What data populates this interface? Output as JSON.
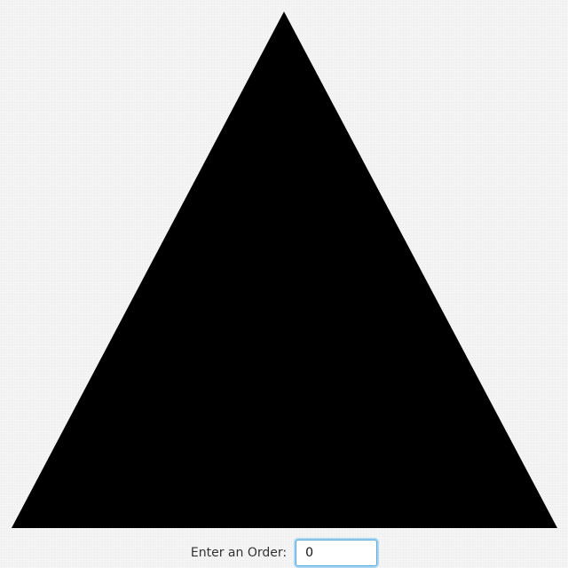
{
  "sierpinski": {
    "order": 0,
    "fill_color": "#000000"
  },
  "controls": {
    "order_label": "Enter an Order:",
    "order_value": "0"
  }
}
